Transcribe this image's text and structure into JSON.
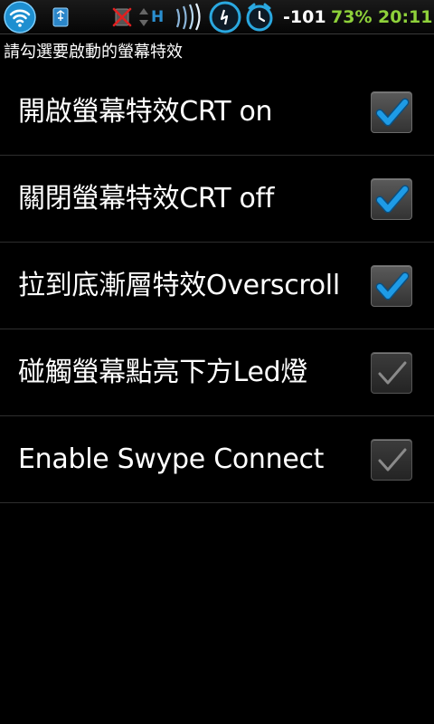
{
  "status_bar": {
    "signal": "-101",
    "battery": "73%",
    "time": "20:11",
    "network_type": "H",
    "icons": [
      "wifi-icon",
      "usb-storage-icon",
      "no-sim-icon",
      "data-arrows-icon",
      "signal-waves-icon",
      "clock-app-icon",
      "alarm-icon"
    ],
    "colors": {
      "signal": "#ffffff",
      "battery": "#8ed13a",
      "time": "#8ed13a",
      "accent": "#2aa8e0"
    }
  },
  "screen": {
    "subtitle": "請勾選要啟動的螢幕特效"
  },
  "settings": [
    {
      "label": "開啟螢幕特效CRT on",
      "checked": true
    },
    {
      "label": "關閉螢幕特效CRT off",
      "checked": true
    },
    {
      "label": "拉到底漸層特效Overscroll",
      "checked": true
    },
    {
      "label": "碰觸螢幕點亮下方Led燈",
      "checked": false
    },
    {
      "label": "Enable Swype Connect",
      "checked": false
    }
  ]
}
